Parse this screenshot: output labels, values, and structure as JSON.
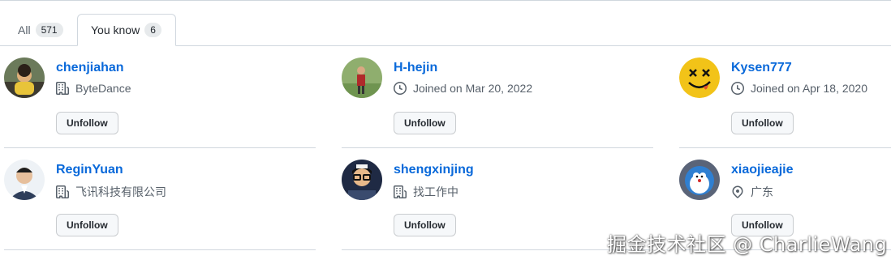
{
  "tabs": [
    {
      "label": "All",
      "count": "571"
    },
    {
      "label": "You know",
      "count": "6"
    }
  ],
  "users": [
    {
      "name": "chenjiahan",
      "meta": "ByteDance",
      "meta_icon": "organization-icon",
      "button": "Unfollow"
    },
    {
      "name": "H-hejin",
      "meta": "Joined on Mar 20, 2022",
      "meta_icon": "clock-icon",
      "button": "Unfollow"
    },
    {
      "name": "Kysen777",
      "meta": "Joined on Apr 18, 2020",
      "meta_icon": "clock-icon",
      "button": "Unfollow"
    },
    {
      "name": "ReginYuan",
      "meta": "飞讯科技有限公司",
      "meta_icon": "organization-icon",
      "button": "Unfollow"
    },
    {
      "name": "shengxinjing",
      "meta": "找工作中",
      "meta_icon": "organization-icon",
      "button": "Unfollow"
    },
    {
      "name": "xiaojieajie",
      "meta": "广东",
      "meta_icon": "location-icon",
      "button": "Unfollow"
    }
  ],
  "colors": {
    "link": "#0969da",
    "muted": "#57606a",
    "border": "#d0d7de"
  },
  "watermark": "掘金技术社区 @ CharlieWang"
}
